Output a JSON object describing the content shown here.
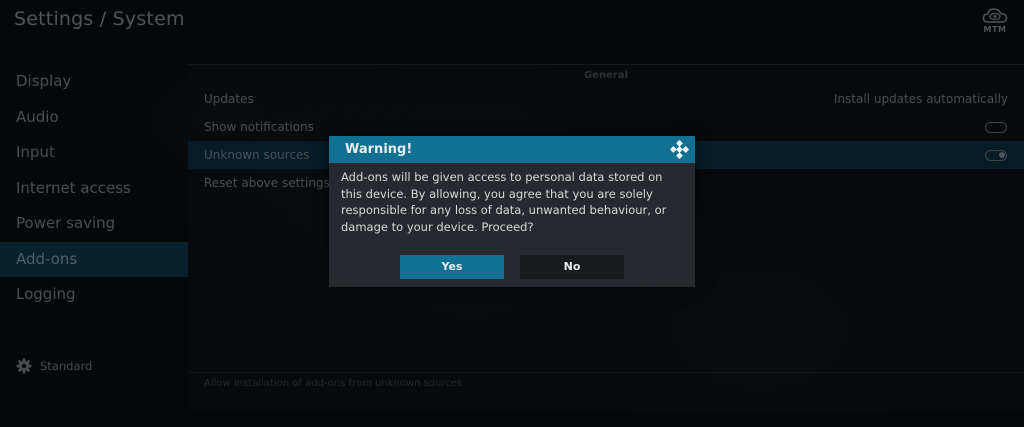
{
  "header": {
    "title": "Settings / System",
    "brand_icon": "eye-cloud-icon",
    "brand_text": "MTM"
  },
  "sidebar": {
    "items": [
      {
        "label": "Display",
        "active": false
      },
      {
        "label": "Audio",
        "active": false
      },
      {
        "label": "Input",
        "active": false
      },
      {
        "label": "Internet access",
        "active": false
      },
      {
        "label": "Power saving",
        "active": false
      },
      {
        "label": "Add-ons",
        "active": true
      },
      {
        "label": "Logging",
        "active": false
      }
    ],
    "level": {
      "icon": "gear-icon",
      "label": "Standard"
    }
  },
  "settings": {
    "group_title": "General",
    "rows": [
      {
        "label": "Updates",
        "value": "Install updates automatically"
      },
      {
        "label": "Show notifications",
        "toggle": false
      },
      {
        "label": "Unknown sources",
        "toggle": true,
        "focused": true
      },
      {
        "label": "Reset above settings to"
      }
    ],
    "hint": "Allow installation of add-ons from unknown sources"
  },
  "dialog": {
    "title": "Warning!",
    "logo_icon": "kodi-logo-icon",
    "message": "Add-ons will be given access to personal data stored on this device. By allowing, you agree that you are solely responsible for any loss of data, unwanted behaviour, or damage to your device. Proceed?",
    "yes_label": "Yes",
    "no_label": "No"
  },
  "colors": {
    "accent": "#127193",
    "focus_row": "#0c3346",
    "sidebar_active": "#0d3a4e",
    "dialog_bg": "#262a2e"
  }
}
